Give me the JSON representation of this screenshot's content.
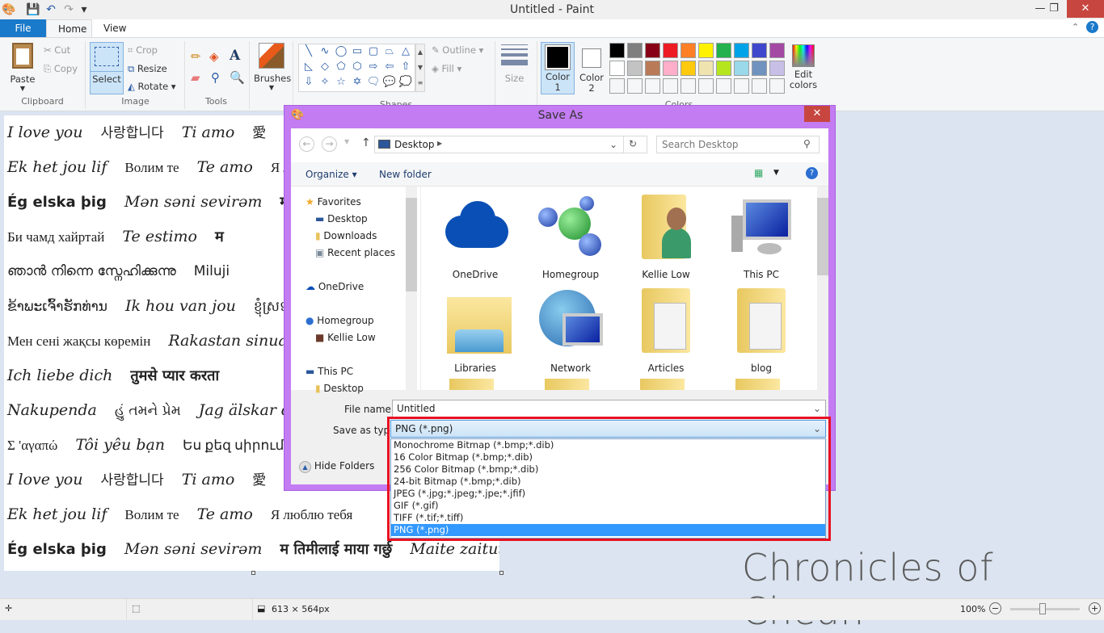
{
  "window": {
    "title": "Untitled - Paint",
    "minimize": "—",
    "restore": "❐",
    "close": "✕"
  },
  "tabs": [
    {
      "label": "File"
    },
    {
      "label": "Home"
    },
    {
      "label": "View"
    }
  ],
  "ribbon": {
    "clipboard": {
      "label": "Clipboard",
      "paste": "Paste",
      "cut": "Cut",
      "copy": "Copy"
    },
    "image": {
      "label": "Image",
      "select": "Select",
      "crop": "Crop",
      "resize": "Resize",
      "rotate": "Rotate"
    },
    "tools": {
      "label": "Tools"
    },
    "brushes": {
      "label": "Brushes"
    },
    "shapes": {
      "label": "Shapes",
      "outline": "Outline",
      "fill": "Fill",
      "glyphs": [
        "╲",
        "∿",
        "◯",
        "▭",
        "▢",
        "⏢",
        "△",
        "◺",
        "◇",
        "⬠",
        "⬡",
        "⇨",
        "⇦",
        "⇧",
        "⇩",
        "✧",
        "☆",
        "✡",
        "🗨",
        "💬",
        "💭"
      ]
    },
    "size": {
      "label": "Size"
    },
    "colors": {
      "label": "Colors",
      "color1": "Color 1",
      "color2": "Color 2",
      "edit": "Edit colors",
      "palette_row1": [
        "#000000",
        "#7f7f7f",
        "#880015",
        "#ed1c24",
        "#ff7f27",
        "#fff200",
        "#22b14c",
        "#00a2e8",
        "#3f48cc",
        "#a349a4"
      ],
      "palette_row2": [
        "#ffffff",
        "#c3c3c3",
        "#b97a57",
        "#ffaec9",
        "#ffc90e",
        "#efe4b0",
        "#b5e61d",
        "#99d9ea",
        "#7092be",
        "#c8bfe7"
      ]
    }
  },
  "canvas_lines": [
    [
      {
        "t": "I love you",
        "s": "sc"
      },
      {
        "t": "사랑합니다",
        "s": ""
      },
      {
        "t": "Ti amo",
        "s": "sc"
      },
      {
        "t": "愛",
        "s": ""
      }
    ],
    [
      {
        "t": "Ek het jou lif",
        "s": "sc"
      },
      {
        "t": "Волим те",
        "s": "sf"
      },
      {
        "t": "Te amo",
        "s": "sc"
      },
      {
        "t": "Я люблю тебя",
        "s": "sf"
      }
    ],
    [
      {
        "t": "Ég elska þig",
        "s": "bd"
      },
      {
        "t": "Mən səni sevirəm",
        "s": "sc"
      },
      {
        "t": "म तिमीलाई माया गर्छु",
        "s": "bd"
      }
    ],
    [
      {
        "t": "Би чамд хайртай",
        "s": "sf"
      },
      {
        "t": "Te estimo",
        "s": "sc"
      },
      {
        "t": "म",
        "s": "bd"
      }
    ],
    [
      {
        "t": "ഞാൻ നിന്നെ സ്നേഹിക്കുന്നു",
        "s": ""
      },
      {
        "t": "Miluji",
        "s": ""
      }
    ],
    [
      {
        "t": "ຂ້າພະເຈົ້າຮັກທ່ານ",
        "s": ""
      },
      {
        "t": "Ik hou van jou",
        "s": "sc"
      },
      {
        "t": "ខ្ញុំស្រឡាញ់",
        "s": ""
      }
    ],
    [
      {
        "t": "Мен сені жақсы көремін",
        "s": "sf"
      },
      {
        "t": "Rakastan sinua",
        "s": "sc"
      }
    ],
    [
      {
        "t": "Ich liebe dich",
        "s": "sc"
      },
      {
        "t": "तुमसे प्यार करता",
        "s": "bd"
      }
    ],
    [
      {
        "t": "Nakupenda",
        "s": "sc"
      },
      {
        "t": "હું તમને પ્રેમ",
        "s": ""
      },
      {
        "t": "Jag älskar dig",
        "s": "sc"
      }
    ],
    [
      {
        "t": "Σ 'αγαπώ",
        "s": "sf"
      },
      {
        "t": "Tôi yêu bạn",
        "s": "sc"
      },
      {
        "t": "Ես քեզ սիրում",
        "s": "sf"
      }
    ],
    [
      {
        "t": "I love you",
        "s": "sc"
      },
      {
        "t": "사랑합니다",
        "s": ""
      },
      {
        "t": "Ti amo",
        "s": "sc"
      },
      {
        "t": "愛",
        "s": ""
      }
    ],
    [
      {
        "t": "Ek het jou lif",
        "s": "sc"
      },
      {
        "t": "Волим те",
        "s": "sf"
      },
      {
        "t": "Te amo",
        "s": "sc"
      },
      {
        "t": "Я люблю тебя",
        "s": "sf"
      }
    ],
    [
      {
        "t": "Ég elska þig",
        "s": "bd"
      },
      {
        "t": "Mən səni sevirəm",
        "s": "sc"
      },
      {
        "t": "म तिमीलाई माया गर्छु",
        "s": "bd"
      },
      {
        "t": "Maite zaitut",
        "s": "sc"
      }
    ]
  ],
  "status": {
    "size": "613 × 564px",
    "zoom": "100%",
    "zoom_percent": 100
  },
  "watermark": "Chronicles of Chean",
  "dialog": {
    "title": "Save As",
    "address": "Desktop",
    "search_placeholder": "Search Desktop",
    "organize": "Organize ▾",
    "new_folder": "New folder",
    "tree": [
      {
        "label": "Favorites",
        "icon": "★",
        "color": "#f5a623",
        "indent": 0
      },
      {
        "label": "Desktop",
        "icon": "▬",
        "color": "#2b579a",
        "indent": 1
      },
      {
        "label": "Downloads",
        "icon": "▮",
        "color": "#e8c25a",
        "indent": 1
      },
      {
        "label": "Recent places",
        "icon": "▣",
        "color": "#7a8a9a",
        "indent": 1
      },
      {
        "label": "OneDrive",
        "icon": "☁",
        "color": "#0a4fb5",
        "indent": 0
      },
      {
        "label": "Homegroup",
        "icon": "●",
        "color": "#2d6fd1",
        "indent": 0
      },
      {
        "label": "Kellie Low",
        "icon": "■",
        "color": "#6b3a2a",
        "indent": 1
      },
      {
        "label": "This PC",
        "icon": "▬",
        "color": "#2b579a",
        "indent": 0
      },
      {
        "label": "Desktop",
        "icon": "▮",
        "color": "#e8c25a",
        "indent": 1
      }
    ],
    "files": [
      {
        "label": "OneDrive",
        "kind": "cloud"
      },
      {
        "label": "Homegroup",
        "kind": "spheres"
      },
      {
        "label": "Kellie Low",
        "kind": "userfolder"
      },
      {
        "label": "This PC",
        "kind": "monitor"
      },
      {
        "label": "Libraries",
        "kind": "libraries"
      },
      {
        "label": "Network",
        "kind": "network"
      },
      {
        "label": "Articles",
        "kind": "folder"
      },
      {
        "label": "blog",
        "kind": "folder"
      }
    ],
    "file_name_label": "File name:",
    "file_name": "Untitled",
    "type_label": "Save as type:",
    "type_value": "PNG (*.png)",
    "type_options": [
      "Monochrome Bitmap (*.bmp;*.dib)",
      "16 Color Bitmap (*.bmp;*.dib)",
      "256 Color Bitmap (*.bmp;*.dib)",
      "24-bit Bitmap (*.bmp;*.dib)",
      "JPEG (*.jpg;*.jpeg;*.jpe;*.jfif)",
      "GIF (*.gif)",
      "TIFF (*.tif;*.tiff)",
      "PNG (*.png)"
    ],
    "hide_folders": "Hide Folders",
    "highlight_color": "#e81123",
    "frame_color": "#c37cf2"
  }
}
